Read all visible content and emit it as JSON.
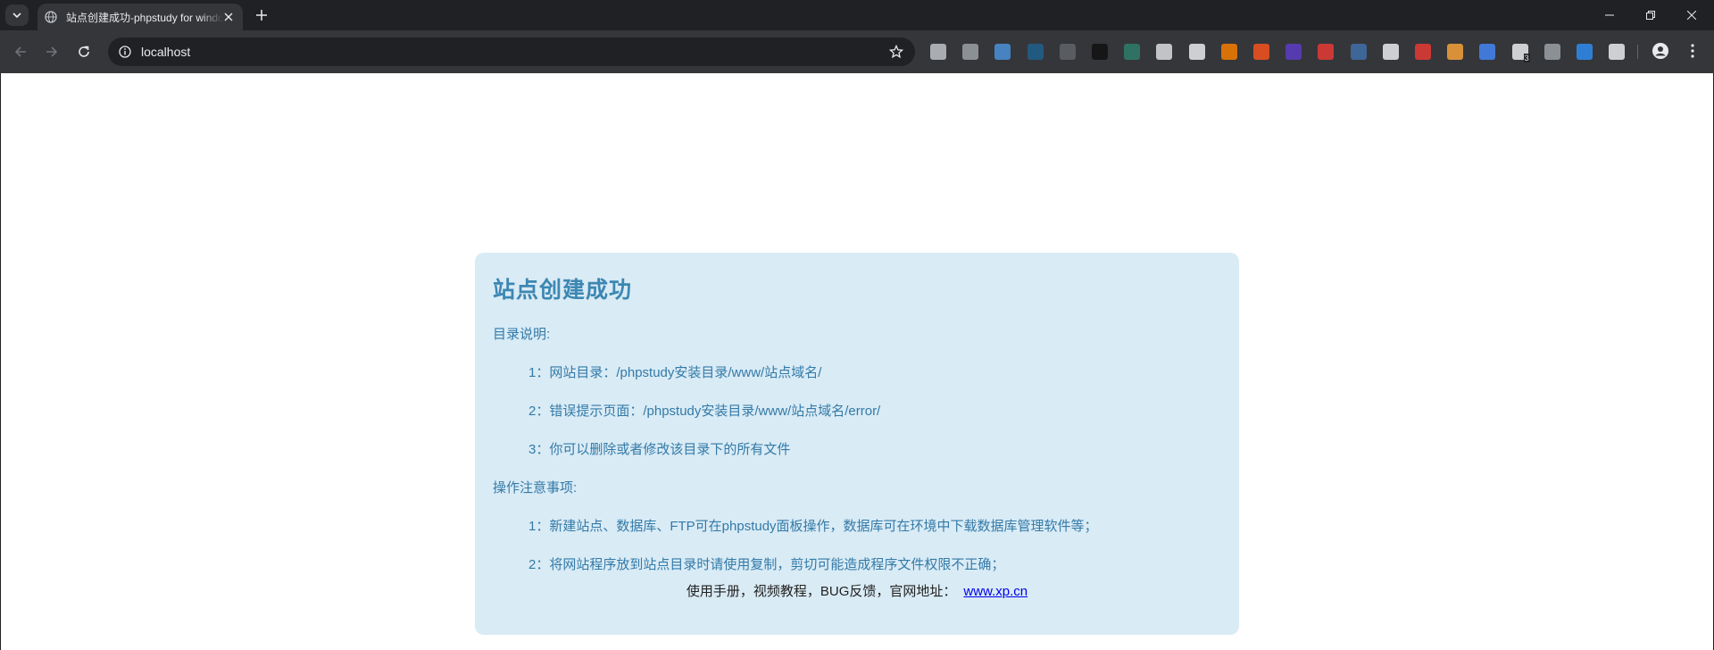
{
  "browser": {
    "tab": {
      "title": "站点创建成功-phpstudy for windows"
    },
    "omnibox": {
      "url": "localhost"
    },
    "extensions": [
      {
        "name": "ext-1-icon",
        "color": "#bdc1c6"
      },
      {
        "name": "ext-2-icon",
        "color": "#9aa0a6"
      },
      {
        "name": "ext-3-icon",
        "color": "#4a90d9"
      },
      {
        "name": "ext-4-icon",
        "color": "#1f5f8b"
      },
      {
        "name": "ext-5-icon",
        "color": "#5f6368"
      },
      {
        "name": "ext-6-icon",
        "color": "#111111"
      },
      {
        "name": "ext-7-icon",
        "color": "#2e7d6b"
      },
      {
        "name": "ext-8-icon",
        "color": "#dadce0"
      },
      {
        "name": "ext-9-icon",
        "color": "#e8eaed"
      },
      {
        "name": "ext-10-icon",
        "color": "#f57c00"
      },
      {
        "name": "ext-11-icon",
        "color": "#f4511e"
      },
      {
        "name": "ext-12-icon",
        "color": "#5b3cc4"
      },
      {
        "name": "ext-13-icon",
        "color": "#e53935"
      },
      {
        "name": "ext-14-icon",
        "color": "#3f6fa8"
      },
      {
        "name": "ext-15-icon",
        "color": "#e8eaed"
      },
      {
        "name": "ext-16-icon",
        "color": "#e53935"
      },
      {
        "name": "ext-17-icon",
        "color": "#f4a03a"
      },
      {
        "name": "ext-18-icon",
        "color": "#4285f4"
      },
      {
        "name": "ext-19-icon",
        "color": "#e8eaed",
        "badge": "3"
      },
      {
        "name": "ext-20-icon",
        "color": "#9aa0a6"
      },
      {
        "name": "ext-21-icon",
        "color": "#2d8cf0"
      },
      {
        "name": "extensions-puzzle-icon",
        "color": "#e8eaed"
      }
    ]
  },
  "page": {
    "heading": "站点创建成功",
    "dir_title": "目录说明:",
    "dir_items": [
      "1：网站目录：/phpstudy安装目录/www/站点域名/",
      "2：错误提示页面：/phpstudy安装目录/www/站点域名/error/",
      "3：你可以删除或者修改该目录下的所有文件"
    ],
    "ops_title": "操作注意事项:",
    "ops_items": [
      "1：新建站点、数据库、FTP可在phpstudy面板操作，数据库可在环境中下载数据库管理软件等；",
      "2：将网站程序放到站点目录时请使用复制，剪切可能造成程序文件权限不正确；"
    ],
    "footer_text": "使用手册，视频教程，BUG反馈，官网地址：",
    "footer_link": "www.xp.cn"
  }
}
